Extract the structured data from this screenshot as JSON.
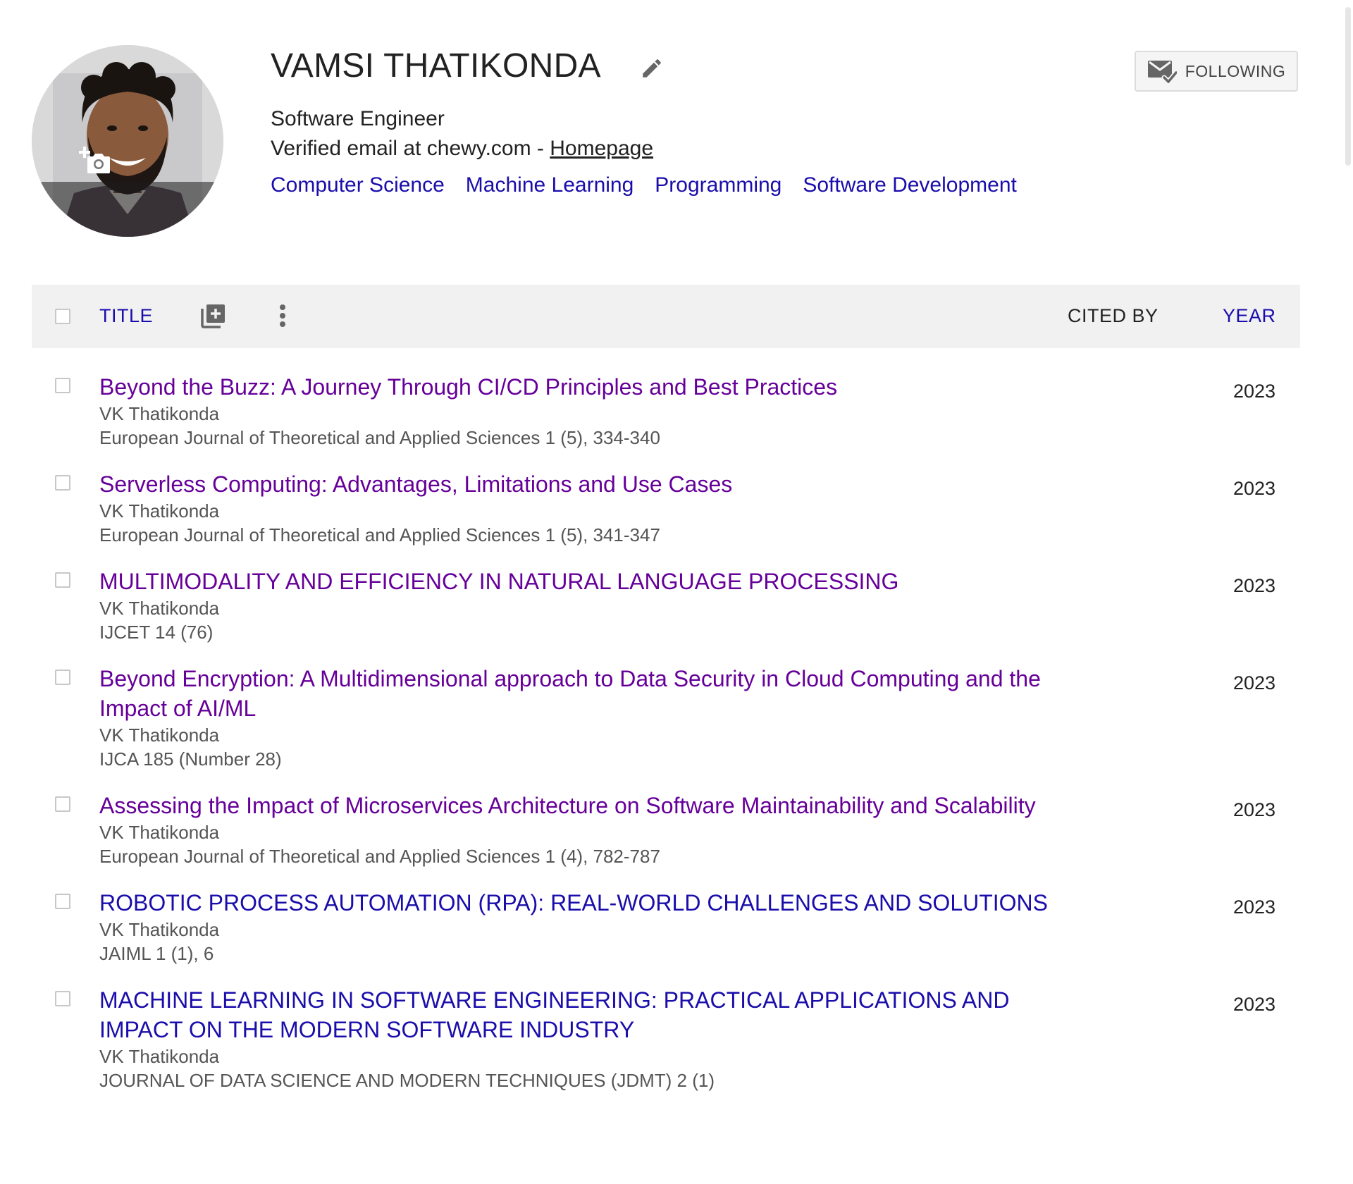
{
  "profile": {
    "name": "VAMSI THATIKONDA",
    "affiliation": "Software Engineer",
    "email_text": "Verified email at chewy.com - ",
    "homepage_label": "Homepage",
    "interests": [
      "Computer Science",
      "Machine Learning",
      "Programming",
      "Software Development"
    ],
    "follow_label": "FOLLOWING",
    "icons": {
      "edit": "pencil-icon",
      "avatar_action": "add-photo-icon",
      "follow": "mail-check-icon"
    }
  },
  "table": {
    "headers": {
      "title": "TITLE",
      "cited_by": "CITED BY",
      "year": "YEAR"
    },
    "icons": {
      "add": "add-to-library-icon",
      "more": "more-vertical-icon"
    }
  },
  "articles": [
    {
      "title": "Beyond the Buzz: A Journey Through CI/CD Principles and Best Practices",
      "authors": "VK Thatikonda",
      "venue": "European Journal of Theoretical and Applied Sciences 1 (5), 334-340",
      "year": "2023",
      "visited": true
    },
    {
      "title": "Serverless Computing: Advantages, Limitations and Use Cases",
      "authors": "VK Thatikonda",
      "venue": "European Journal of Theoretical and Applied Sciences 1 (5), 341-347",
      "year": "2023",
      "visited": true
    },
    {
      "title": "MULTIMODALITY AND EFFICIENCY IN NATURAL LANGUAGE PROCESSING",
      "authors": "VK Thatikonda",
      "venue": "IJCET 14 (76)",
      "year": "2023",
      "visited": true
    },
    {
      "title": "Beyond Encryption: A Multidimensional approach to Data Security in Cloud Computing and the Impact of AI/ML",
      "authors": "VK Thatikonda",
      "venue": "IJCA 185 (Number 28)",
      "year": "2023",
      "visited": true
    },
    {
      "title": "Assessing the Impact of Microservices Architecture on Software Maintainability and Scalability",
      "authors": "VK Thatikonda",
      "venue": "European Journal of Theoretical and Applied Sciences 1 (4), 782-787",
      "year": "2023",
      "visited": true
    },
    {
      "title": "ROBOTIC PROCESS AUTOMATION (RPA): REAL-WORLD CHALLENGES AND SOLUTIONS",
      "authors": "VK Thatikonda",
      "venue": "JAIML 1 (1), 6",
      "year": "2023",
      "visited": false
    },
    {
      "title": "MACHINE LEARNING IN SOFTWARE ENGINEERING: PRACTICAL APPLICATIONS AND IMPACT ON THE MODERN SOFTWARE INDUSTRY",
      "authors": "VK Thatikonda",
      "venue": "JOURNAL OF DATA SCIENCE AND MODERN TECHNIQUES (JDMT) 2 (1)",
      "year": "2023",
      "visited": false
    }
  ],
  "colors": {
    "link": "#1a0dab",
    "visited_link": "#660099",
    "header_bg": "#f1f1f1",
    "secondary_text": "#555555"
  }
}
